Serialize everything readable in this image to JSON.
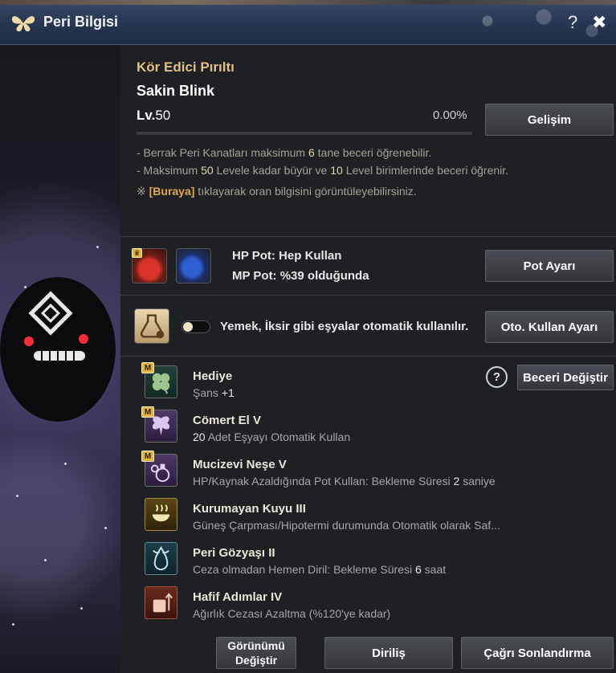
{
  "window": {
    "title": "Peri Bilgisi",
    "help_label": "?",
    "close_label": "✖"
  },
  "fairy": {
    "skill_title": "Kör Edici Pırıltı",
    "name": "Sakin Blink",
    "level_prefix": "Lv.",
    "level": "50",
    "exp_percent": "0.00%",
    "exp_fraction": 0,
    "grow_button": "Gelişim"
  },
  "info": {
    "line1_pre": "- Berrak Peri Kanatları maksimum ",
    "line1_num": "6",
    "line1_post": " tane beceri öğrenebilir.",
    "line2_pre": "- Maksimum ",
    "line2_num1": "50",
    "line2_mid": " Levele kadar büyür ve ",
    "line2_num2": "10",
    "line2_post": " Level birimlerinde beceri öğrenir.",
    "line3_mark": "※ ",
    "line3_link": "[Buraya]",
    "line3_post": " tıklayarak oran bilgisini görüntüleyebilirsiniz."
  },
  "potion": {
    "hp_label": "HP Pot: Hep Kullan",
    "mp_label": "MP Pot: %39 olduğunda",
    "settings_button": "Pot Ayarı"
  },
  "auto_use": {
    "text": "Yemek, İksir gibi eşyalar otomatik kullanılır.",
    "toggle_on": false,
    "settings_button": "Oto. Kullan Ayarı"
  },
  "skills_panel": {
    "help_label": "?",
    "change_button": "Beceri Değiştir"
  },
  "skills": [
    {
      "badge": "M",
      "name": "Hediye",
      "desc_pre": "Şans ",
      "desc_num": "+1",
      "desc_post": "",
      "icon": "clover-icon"
    },
    {
      "badge": "M",
      "name": "Cömert El V",
      "desc_pre": "",
      "desc_num": "20",
      "desc_post": " Adet Eşyayı Otomatik Kullan",
      "icon": "fairy-icon"
    },
    {
      "badge": "M",
      "name": "Mucizevi Neşe V",
      "desc_pre": "HP/Kaynak Azaldığında Pot Kullan: Bekleme Süresi ",
      "desc_num": "2",
      "desc_post": " saniye",
      "icon": "potions-icon"
    },
    {
      "badge": "",
      "name": "Kurumayan Kuyu III",
      "desc_pre": "Güneş Çarpması/Hipotermi durumunda Otomatik olarak Saf...",
      "desc_num": "",
      "desc_post": "",
      "icon": "bowl-icon"
    },
    {
      "badge": "",
      "name": "Peri Gözyaşı II",
      "desc_pre": "Ceza olmadan Hemen Diril: Bekleme Süresi ",
      "desc_num": "6",
      "desc_post": " saat",
      "icon": "tear-icon"
    },
    {
      "badge": "",
      "name": "Hafif Adımlar IV",
      "desc_pre": "Ağırlık Cezası Azaltma (%120'ye kadar)",
      "desc_num": "",
      "desc_post": "",
      "icon": "weight-icon"
    }
  ],
  "footer": {
    "appearance_line1": "Görünümü",
    "appearance_line2": "Değiştir",
    "revive_button": "Diriliş",
    "dismiss_button": "Çağrı Sonlandırma"
  },
  "colors": {
    "accent_gold": "#e0c08a",
    "title_blue": "#253652",
    "panel": "#1f2024"
  }
}
